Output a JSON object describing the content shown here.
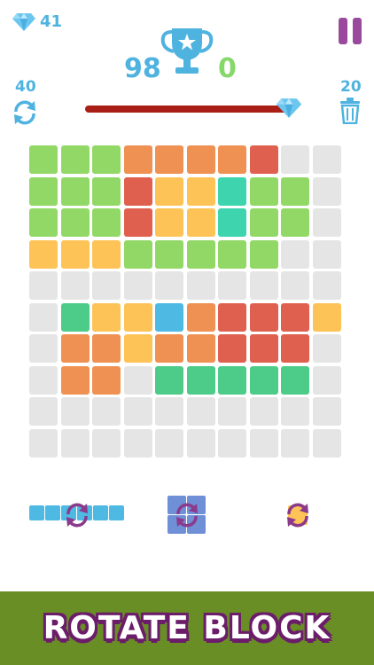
{
  "hud": {
    "gems": "41",
    "best_score": "98",
    "current_score": "0",
    "rotate_count": "40",
    "trash_count": "20",
    "progress": 0.97
  },
  "colors": {
    "G": "#92d866",
    "O": "#ef9152",
    "R": "#e0604f",
    "Y": "#fdc357",
    "T": "#3dd4ae",
    "E": "#4dcb88",
    "B": "#4eb9e2",
    "_": "#e5e5e5"
  },
  "board": [
    "GGGOOOOR__",
    "GGGRYYTGG_",
    "GGGRYYTGG_",
    "YYYGGGGG__",
    "__________",
    "_EYYBORRRY",
    "_OOYOORRR_",
    "_OO_EEEEE_",
    "__________",
    "__________"
  ],
  "pieces": [
    {
      "kind": "bar-1x6",
      "color": "#4eb9e2",
      "rotatable": true
    },
    {
      "kind": "square-2x2",
      "color": "#6f8fd6",
      "rotatable": true
    },
    {
      "kind": "single",
      "color": "#fdc357",
      "rotatable": true
    }
  ],
  "banner": {
    "label": "ROTATE BLOCK"
  }
}
